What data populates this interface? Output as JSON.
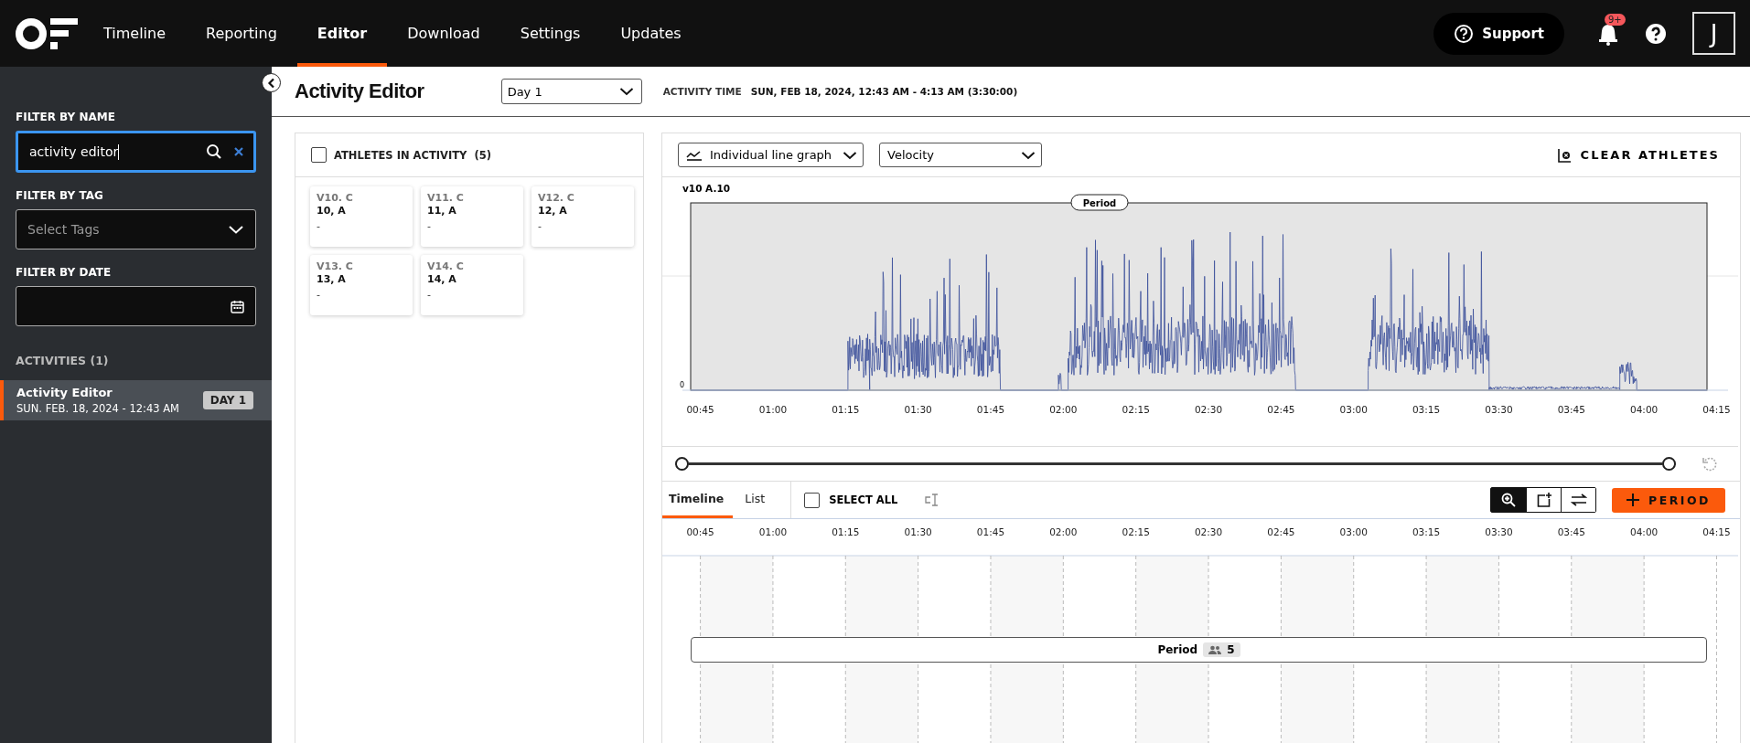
{
  "nav": {
    "items": [
      {
        "label": "Timeline",
        "selected": false
      },
      {
        "label": "Reporting",
        "selected": false
      },
      {
        "label": "Editor",
        "selected": true
      },
      {
        "label": "Download",
        "selected": false
      },
      {
        "label": "Settings",
        "selected": false
      },
      {
        "label": "Updates",
        "selected": false
      }
    ],
    "support": "Support",
    "notification_badge": "9+",
    "avatar": "J"
  },
  "header": {
    "title": "Activity Editor",
    "day_select": "Day 1",
    "activity_time_label": "ACTIVITY TIME",
    "activity_time": "SUN, FEB 18, 2024, 12:43 AM - 4:13 AM (3:30:00)"
  },
  "sidebar": {
    "filter_name": {
      "label": "FILTER BY NAME",
      "value": "activity editor"
    },
    "filter_tag": {
      "label": "FILTER BY TAG",
      "placeholder": "Select Tags"
    },
    "filter_date": {
      "label": "FILTER BY DATE"
    },
    "activities_heading": "ACTIVITIES (1)",
    "activities": [
      {
        "name": "Activity Editor",
        "date": "SUN. FEB. 18, 2024 - 12:43 AM",
        "badge": "DAY 1",
        "selected": true
      }
    ]
  },
  "athletes": {
    "title": "ATHLETES IN ACTIVITY",
    "count": "(5)",
    "checked": false,
    "cards": [
      {
        "code": "V10. C",
        "name": "10, A",
        "note": "-"
      },
      {
        "code": "V11. C",
        "name": "11, A",
        "note": "-"
      },
      {
        "code": "V12. C",
        "name": "12, A",
        "note": "-"
      },
      {
        "code": "V13. C",
        "name": "13, A",
        "note": "-"
      },
      {
        "code": "V14. C",
        "name": "14, A",
        "note": "-"
      }
    ]
  },
  "chart_panel": {
    "graph_type": "Individual line graph",
    "metric": "Velocity",
    "clear_button": "CLEAR ATHLETES",
    "series_label": "v10 A.10",
    "period_label": "Period",
    "y_tick": "0",
    "x_ticks": [
      "00:45",
      "01:00",
      "01:15",
      "01:30",
      "01:45",
      "02:00",
      "02:15",
      "02:30",
      "02:45",
      "03:00",
      "03:15",
      "03:30",
      "03:45",
      "04:00",
      "04:15"
    ],
    "range_handles": [
      {
        "level": 0
      },
      {
        "level": 1
      }
    ]
  },
  "timeline": {
    "tabs": [
      {
        "label": "Timeline",
        "selected": true
      },
      {
        "label": "List",
        "selected": false
      }
    ],
    "select_all": {
      "label": "SELECT ALL",
      "checked": false
    },
    "tools": [
      {
        "kind": "zoom",
        "selected": true
      },
      {
        "kind": "add",
        "selected": false
      },
      {
        "kind": "swap",
        "selected": false
      }
    ],
    "add_button": "PERIOD",
    "ticks": [
      "00:45",
      "01:00",
      "01:15",
      "01:30",
      "01:45",
      "02:00",
      "02:15",
      "02:30",
      "02:45",
      "03:00",
      "03:15",
      "03:30",
      "03:45",
      "04:00",
      "04:15"
    ],
    "periods": [
      {
        "label": "Period",
        "count": "5"
      }
    ]
  }
}
